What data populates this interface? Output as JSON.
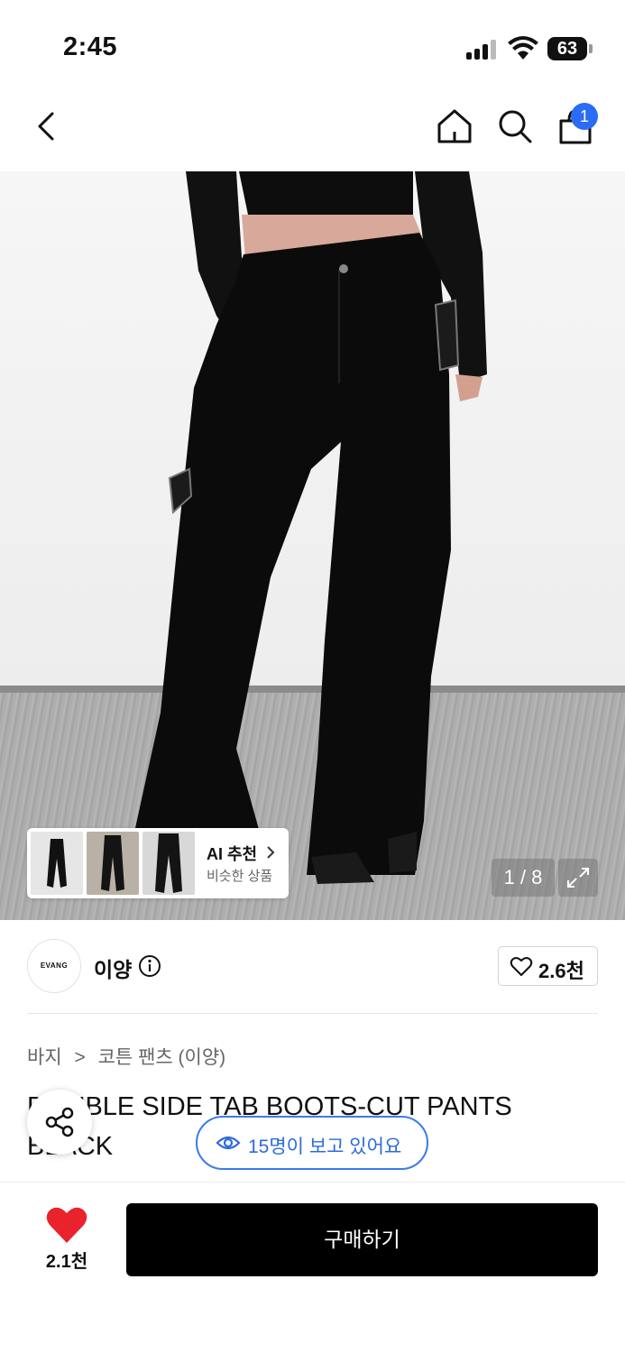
{
  "status_bar": {
    "time": "2:45",
    "battery": "63"
  },
  "nav": {
    "back_icon": "chevron-left-icon",
    "home_icon": "home-icon",
    "search_icon": "search-icon",
    "cart_icon": "shopping-bag-icon",
    "cart_count": "1",
    "badge_color": "#2b6cf6"
  },
  "gallery": {
    "ai_title": "AI 추천",
    "ai_subtitle": "비슷한 상품",
    "pager": "1 / 8",
    "expand_icon": "expand-icon"
  },
  "brand": {
    "logo_text": "EVANG",
    "name": "이양",
    "like_count": "2.6천"
  },
  "breadcrumb": {
    "category": "바지",
    "separator": ">",
    "subcategory": "코튼 팬츠 (이양)"
  },
  "product": {
    "title": "DOUBLE SIDE TAB BOOTS-CUT PANTS BLACK"
  },
  "floating": {
    "share_icon": "share-icon",
    "viewers": "15명이 보고 있어요",
    "accent_color": "#3d7be8"
  },
  "bottom_bar": {
    "like_count": "2.1천",
    "buy_label": "구매하기",
    "heart_color": "#e8232c"
  }
}
